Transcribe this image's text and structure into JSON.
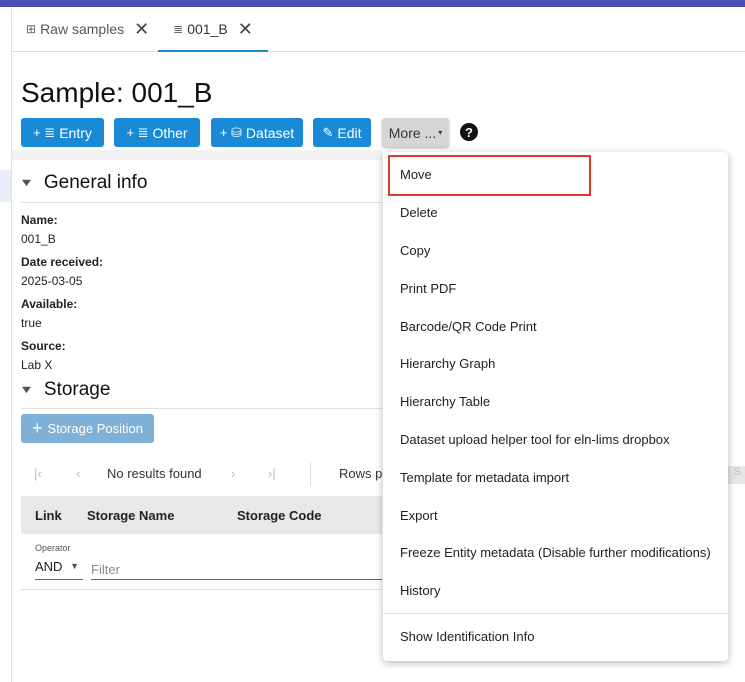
{
  "tabs": [
    {
      "label": "Raw samples",
      "icon": "table-icon"
    },
    {
      "label": "001_B",
      "icon": "lines-icon"
    }
  ],
  "page": {
    "title": "Sample: 001_B"
  },
  "toolbar": {
    "entry_label": "Entry",
    "other_label": "Other",
    "dataset_label": "Dataset",
    "edit_label": "Edit",
    "more_label": "More ..."
  },
  "general_info": {
    "heading": "General info",
    "fields": [
      {
        "label": "Name:",
        "value": "001_B"
      },
      {
        "label": "Date received:",
        "value": "2025-03-05"
      },
      {
        "label": "Available:",
        "value": "true"
      },
      {
        "label": "Source:",
        "value": "Lab X"
      }
    ]
  },
  "storage": {
    "heading": "Storage",
    "add_button": "Storage Position",
    "pager_text": "No results found",
    "rows_label": "Rows p",
    "columns": [
      "Link",
      "Storage Name",
      "Storage Code"
    ],
    "operator_label": "Operator",
    "operator_value": "AND",
    "filter_placeholder": "Filter"
  },
  "menu": {
    "items": [
      "Move",
      "Delete",
      "Copy",
      "Print PDF",
      "Barcode/QR Code Print",
      "Hierarchy Graph",
      "Hierarchy Table",
      "Dataset upload helper tool for eln-lims dropbox",
      "Template for metadata import",
      "Export",
      "Freeze Entity metadata (Disable further modifications)",
      "History",
      "Show Identification Info"
    ],
    "highlighted": "Move"
  },
  "colors": {
    "primary": "#1a8ad6",
    "topbar": "#4a4fb5",
    "highlight": "#e53524"
  }
}
